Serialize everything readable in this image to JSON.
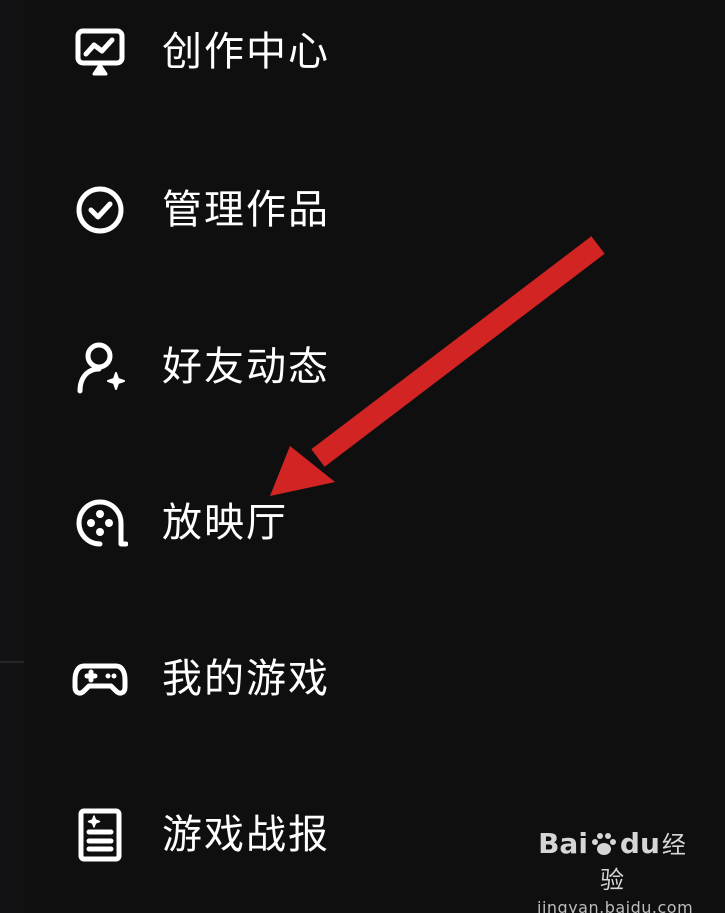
{
  "menu": {
    "items": [
      {
        "label": "创作中心",
        "icon": "creator-center-icon"
      },
      {
        "label": "管理作品",
        "icon": "check-circle-icon"
      },
      {
        "label": "好友动态",
        "icon": "user-sparkle-icon"
      },
      {
        "label": "放映厅",
        "icon": "film-reel-icon"
      },
      {
        "label": "我的游戏",
        "icon": "gamepad-icon"
      },
      {
        "label": "游戏战报",
        "icon": "report-document-icon"
      }
    ]
  },
  "annotation": {
    "arrow_color": "#d32424",
    "points_to": "放映厅"
  },
  "watermark": {
    "brand_left": "Bai",
    "brand_right": "du",
    "product": "经验",
    "url": "jingyan.baidu.com"
  },
  "colors": {
    "background": "#0f0f10",
    "text": "#ffffff",
    "accent_arrow": "#d32424"
  }
}
